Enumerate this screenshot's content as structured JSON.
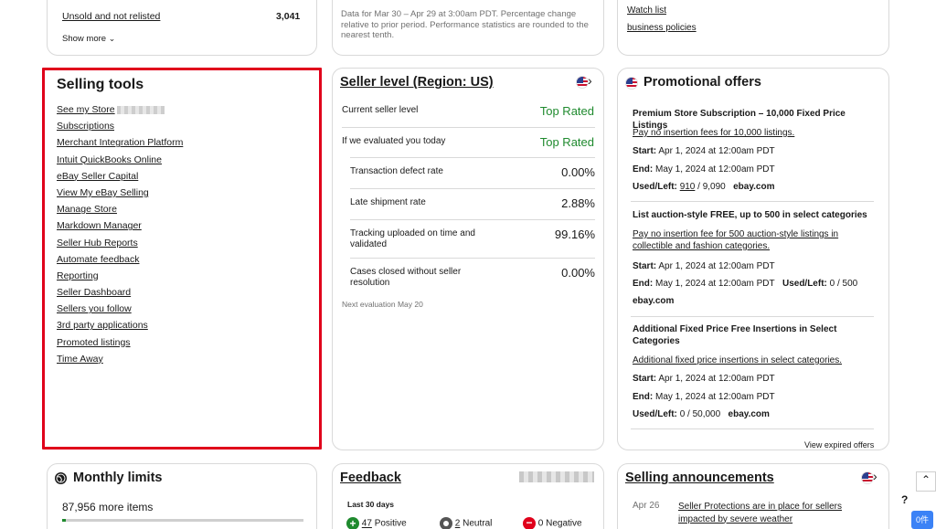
{
  "top_left": {
    "unsold_label": "Unsold and not relisted",
    "unsold_count": "3,041",
    "show_more": "Show more"
  },
  "top_mid": {
    "note": "Data for Mar 30 – Apr 29 at 3:00am PDT. Percentage change relative to prior period. Performance statistics are rounded to the nearest tenth."
  },
  "top_right": {
    "watch_list": "Watch list",
    "business_policies": "business policies"
  },
  "selling_tools": {
    "title": "Selling tools",
    "items": [
      "See my Store",
      "Subscriptions",
      "Merchant Integration Platform",
      "Intuit QuickBooks Online",
      "eBay Seller Capital",
      "View My eBay Selling",
      "Manage Store",
      "Markdown Manager",
      "Seller Hub Reports",
      "Automate feedback",
      "Reporting",
      "Seller Dashboard",
      "Sellers you follow",
      "3rd party applications",
      "Promoted listings",
      "Time Away"
    ]
  },
  "seller_level": {
    "title": "Seller level (Region: US)",
    "current_label": "Current seller level",
    "current_value": "Top Rated",
    "evaluated_label": "If we evaluated you today",
    "evaluated_value": "Top Rated",
    "metrics": [
      {
        "label": "Transaction defect rate",
        "value": "0.00%"
      },
      {
        "label": "Late shipment rate",
        "value": "2.88%"
      },
      {
        "label": "Tracking uploaded on time and validated",
        "value": "99.16%"
      },
      {
        "label": "Cases closed without seller resolution",
        "value": "0.00%"
      }
    ],
    "next_eval": "Next evaluation May 20"
  },
  "promotional_offers": {
    "title": "Promotional offers",
    "offer1": {
      "title": "Premium Store Subscription – 10,000 Fixed Price Listings",
      "link": "Pay no insertion fees for 10,000 listings.",
      "start_label": "Start:",
      "start": "Apr 1, 2024 at 12:00am PDT",
      "end_label": "End:",
      "end": "May 1, 2024 at 12:00am PDT",
      "used_label": "Used/Left:",
      "used": "910",
      "left": "/ 9,090",
      "site": "ebay.com"
    },
    "offer2": {
      "title": "List auction-style FREE, up to 500 in select categories",
      "link": "Pay no insertion fee for 500 auction-style listings in collectible and fashion categories.",
      "start_label": "Start:",
      "start": "Apr 1, 2024 at 12:00am PDT",
      "end_label": "End:",
      "end": "May 1, 2024 at 12:00am PDT",
      "used_label": "Used/Left:",
      "used": "0",
      "left": "/ 500",
      "site": "ebay.com"
    },
    "offer3": {
      "title": "Additional Fixed Price Free Insertions in Select Categories",
      "link": "Additional fixed price insertions in select categories.",
      "start_label": "Start:",
      "start": "Apr 1, 2024 at 12:00am PDT",
      "end_label": "End:",
      "end": "May 1, 2024 at 12:00am PDT",
      "used_label": "Used/Left:",
      "used": "0",
      "left": "/ 50,000",
      "site": "ebay.com"
    },
    "view_expired": "View expired offers"
  },
  "monthly_limits": {
    "title": "Monthly limits",
    "items_left": "87,956 more items"
  },
  "feedback": {
    "title": "Feedback",
    "period": "Last 30 days",
    "positive_count": "47",
    "positive_label": "Positive",
    "neutral_count": "2",
    "neutral_label": "Neutral",
    "negative_count": "0",
    "negative_label": "Negative"
  },
  "announcements": {
    "title": "Selling announcements",
    "items": [
      {
        "date": "Apr 26",
        "text": "Seller Protections are in place for sellers impacted by severe weather"
      }
    ]
  },
  "side": {
    "help": "?",
    "badge": "0件"
  },
  "colors": {
    "highlight": "#e0001b",
    "top_rated": "#1f8a2e",
    "positive": "#1f8a2e",
    "negative": "#e0001b"
  }
}
